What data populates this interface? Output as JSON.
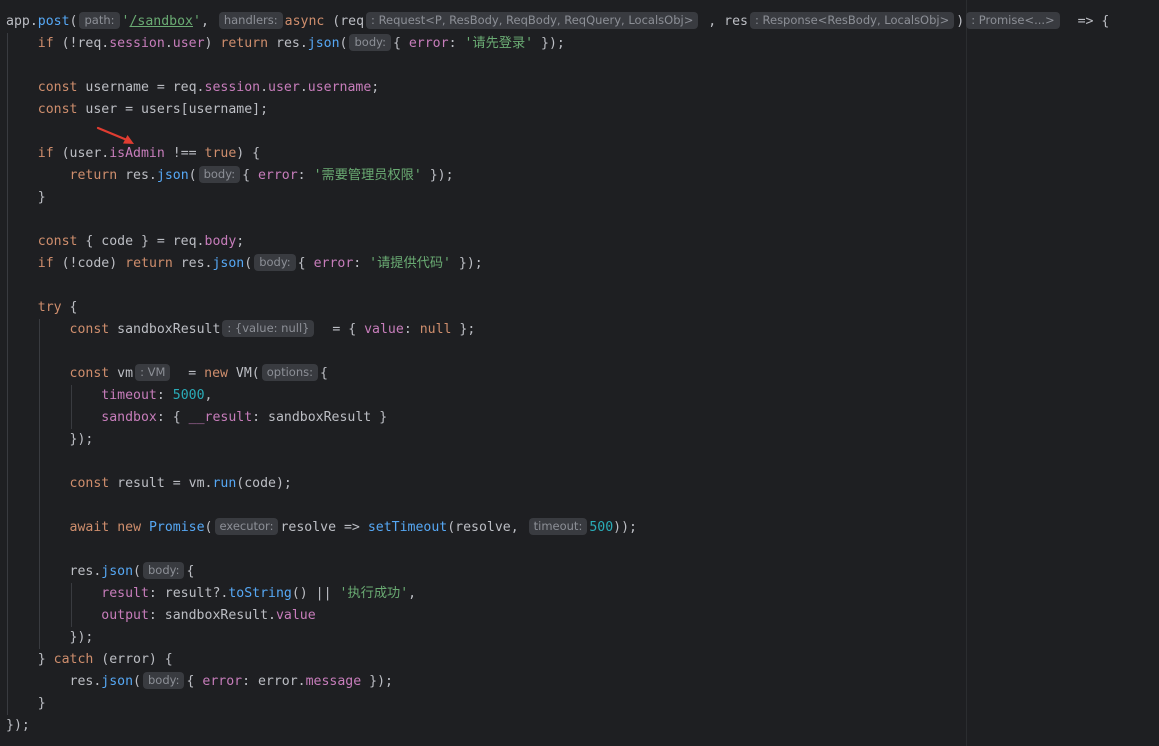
{
  "editor": {
    "lines": [
      [
        {
          "t": "plain",
          "v": "app."
        },
        {
          "t": "fn",
          "v": "post"
        },
        {
          "t": "plain",
          "v": "("
        },
        {
          "t": "hint",
          "v": "path:"
        },
        {
          "t": "str",
          "v": "'"
        },
        {
          "t": "link",
          "v": "/sandbox"
        },
        {
          "t": "str",
          "v": "'"
        },
        {
          "t": "plain",
          "v": ", "
        },
        {
          "t": "hint",
          "v": "handlers:"
        },
        {
          "t": "kw",
          "v": "async"
        },
        {
          "t": "plain",
          "v": " (req"
        },
        {
          "t": "hint",
          "v": ": Request<P, ResBody, ReqBody, ReqQuery, LocalsObj>"
        },
        {
          "t": "plain",
          "v": " , res"
        },
        {
          "t": "hint",
          "v": ": Response<ResBody, LocalsObj>"
        },
        {
          "t": "plain",
          "v": ")"
        },
        {
          "t": "hint",
          "v": ": Promise<...>"
        },
        {
          "t": "plain",
          "v": "  => {"
        }
      ],
      [
        {
          "t": "plain",
          "v": "    "
        },
        {
          "t": "kw",
          "v": "if"
        },
        {
          "t": "plain",
          "v": " (!req."
        },
        {
          "t": "prop",
          "v": "session"
        },
        {
          "t": "plain",
          "v": "."
        },
        {
          "t": "prop",
          "v": "user"
        },
        {
          "t": "plain",
          "v": ") "
        },
        {
          "t": "kw",
          "v": "return"
        },
        {
          "t": "plain",
          "v": " res."
        },
        {
          "t": "fn",
          "v": "json"
        },
        {
          "t": "plain",
          "v": "("
        },
        {
          "t": "hint",
          "v": "body:"
        },
        {
          "t": "plain",
          "v": "{ "
        },
        {
          "t": "prop",
          "v": "error"
        },
        {
          "t": "plain",
          "v": ": "
        },
        {
          "t": "str",
          "v": "'请先登录'"
        },
        {
          "t": "plain",
          "v": " });"
        }
      ],
      [],
      [
        {
          "t": "plain",
          "v": "    "
        },
        {
          "t": "kw",
          "v": "const"
        },
        {
          "t": "plain",
          "v": " username = req."
        },
        {
          "t": "prop",
          "v": "session"
        },
        {
          "t": "plain",
          "v": "."
        },
        {
          "t": "prop",
          "v": "user"
        },
        {
          "t": "plain",
          "v": "."
        },
        {
          "t": "prop",
          "v": "username"
        },
        {
          "t": "plain",
          "v": ";"
        }
      ],
      [
        {
          "t": "plain",
          "v": "    "
        },
        {
          "t": "kw",
          "v": "const"
        },
        {
          "t": "plain",
          "v": " user = users[username];"
        }
      ],
      [],
      [
        {
          "t": "plain",
          "v": "    "
        },
        {
          "t": "kw",
          "v": "if"
        },
        {
          "t": "plain",
          "v": " (user."
        },
        {
          "t": "prop",
          "v": "isAdmin"
        },
        {
          "t": "plain",
          "v": " !== "
        },
        {
          "t": "kw",
          "v": "true"
        },
        {
          "t": "plain",
          "v": ") {"
        }
      ],
      [
        {
          "t": "plain",
          "v": "        "
        },
        {
          "t": "kw",
          "v": "return"
        },
        {
          "t": "plain",
          "v": " res."
        },
        {
          "t": "fn",
          "v": "json"
        },
        {
          "t": "plain",
          "v": "("
        },
        {
          "t": "hint",
          "v": "body:"
        },
        {
          "t": "plain",
          "v": "{ "
        },
        {
          "t": "prop",
          "v": "error"
        },
        {
          "t": "plain",
          "v": ": "
        },
        {
          "t": "str",
          "v": "'需要管理员权限'"
        },
        {
          "t": "plain",
          "v": " });"
        }
      ],
      [
        {
          "t": "plain",
          "v": "    }"
        }
      ],
      [],
      [
        {
          "t": "plain",
          "v": "    "
        },
        {
          "t": "kw",
          "v": "const"
        },
        {
          "t": "plain",
          "v": " { code } = req."
        },
        {
          "t": "prop",
          "v": "body"
        },
        {
          "t": "plain",
          "v": ";"
        }
      ],
      [
        {
          "t": "plain",
          "v": "    "
        },
        {
          "t": "kw",
          "v": "if"
        },
        {
          "t": "plain",
          "v": " (!code) "
        },
        {
          "t": "kw",
          "v": "return"
        },
        {
          "t": "plain",
          "v": " res."
        },
        {
          "t": "fn",
          "v": "json"
        },
        {
          "t": "plain",
          "v": "("
        },
        {
          "t": "hint",
          "v": "body:"
        },
        {
          "t": "plain",
          "v": "{ "
        },
        {
          "t": "prop",
          "v": "error"
        },
        {
          "t": "plain",
          "v": ": "
        },
        {
          "t": "str",
          "v": "'请提供代码'"
        },
        {
          "t": "plain",
          "v": " });"
        }
      ],
      [],
      [
        {
          "t": "plain",
          "v": "    "
        },
        {
          "t": "kw",
          "v": "try"
        },
        {
          "t": "plain",
          "v": " {"
        }
      ],
      [
        {
          "t": "plain",
          "v": "        "
        },
        {
          "t": "kw",
          "v": "const"
        },
        {
          "t": "plain",
          "v": " sandboxResult"
        },
        {
          "t": "hint",
          "v": ": {value: null}"
        },
        {
          "t": "plain",
          "v": "  = { "
        },
        {
          "t": "prop",
          "v": "value"
        },
        {
          "t": "plain",
          "v": ": "
        },
        {
          "t": "kw",
          "v": "null"
        },
        {
          "t": "plain",
          "v": " };"
        }
      ],
      [],
      [
        {
          "t": "plain",
          "v": "        "
        },
        {
          "t": "kw",
          "v": "const"
        },
        {
          "t": "plain",
          "v": " vm"
        },
        {
          "t": "hint",
          "v": ": VM"
        },
        {
          "t": "plain",
          "v": "  = "
        },
        {
          "t": "kw",
          "v": "new"
        },
        {
          "t": "plain",
          "v": " VM("
        },
        {
          "t": "hint",
          "v": "options:"
        },
        {
          "t": "plain",
          "v": "{"
        }
      ],
      [
        {
          "t": "plain",
          "v": "            "
        },
        {
          "t": "prop",
          "v": "timeout"
        },
        {
          "t": "plain",
          "v": ": "
        },
        {
          "t": "num",
          "v": "5000"
        },
        {
          "t": "plain",
          "v": ","
        }
      ],
      [
        {
          "t": "plain",
          "v": "            "
        },
        {
          "t": "prop",
          "v": "sandbox"
        },
        {
          "t": "plain",
          "v": ": { "
        },
        {
          "t": "prop",
          "v": "__result"
        },
        {
          "t": "plain",
          "v": ": sandboxResult }"
        }
      ],
      [
        {
          "t": "plain",
          "v": "        });"
        }
      ],
      [],
      [
        {
          "t": "plain",
          "v": "        "
        },
        {
          "t": "kw",
          "v": "const"
        },
        {
          "t": "plain",
          "v": " result = vm."
        },
        {
          "t": "fn",
          "v": "run"
        },
        {
          "t": "plain",
          "v": "(code);"
        }
      ],
      [],
      [
        {
          "t": "plain",
          "v": "        "
        },
        {
          "t": "kw",
          "v": "await"
        },
        {
          "t": "plain",
          "v": " "
        },
        {
          "t": "kw",
          "v": "new"
        },
        {
          "t": "plain",
          "v": " "
        },
        {
          "t": "fn",
          "v": "Promise"
        },
        {
          "t": "plain",
          "v": "("
        },
        {
          "t": "hint",
          "v": "executor:"
        },
        {
          "t": "plain",
          "v": "resolve => "
        },
        {
          "t": "fn",
          "v": "setTimeout"
        },
        {
          "t": "plain",
          "v": "(resolve, "
        },
        {
          "t": "hint",
          "v": "timeout:"
        },
        {
          "t": "num",
          "v": "500"
        },
        {
          "t": "plain",
          "v": "));"
        }
      ],
      [],
      [
        {
          "t": "plain",
          "v": "        res."
        },
        {
          "t": "fn",
          "v": "json"
        },
        {
          "t": "plain",
          "v": "("
        },
        {
          "t": "hint",
          "v": "body:"
        },
        {
          "t": "plain",
          "v": "{"
        }
      ],
      [
        {
          "t": "plain",
          "v": "            "
        },
        {
          "t": "prop",
          "v": "result"
        },
        {
          "t": "plain",
          "v": ": result?."
        },
        {
          "t": "fn",
          "v": "toString"
        },
        {
          "t": "plain",
          "v": "() || "
        },
        {
          "t": "str",
          "v": "'执行成功'"
        },
        {
          "t": "plain",
          "v": ","
        }
      ],
      [
        {
          "t": "plain",
          "v": "            "
        },
        {
          "t": "prop",
          "v": "output"
        },
        {
          "t": "plain",
          "v": ": sandboxResult."
        },
        {
          "t": "prop",
          "v": "value"
        }
      ],
      [
        {
          "t": "plain",
          "v": "        });"
        }
      ],
      [
        {
          "t": "plain",
          "v": "    } "
        },
        {
          "t": "kw",
          "v": "catch"
        },
        {
          "t": "plain",
          "v": " (error) {"
        }
      ],
      [
        {
          "t": "plain",
          "v": "        res."
        },
        {
          "t": "fn",
          "v": "json"
        },
        {
          "t": "plain",
          "v": "("
        },
        {
          "t": "hint",
          "v": "body:"
        },
        {
          "t": "plain",
          "v": "{ "
        },
        {
          "t": "prop",
          "v": "error"
        },
        {
          "t": "plain",
          "v": ": error."
        },
        {
          "t": "prop",
          "v": "message"
        },
        {
          "t": "plain",
          "v": " });"
        }
      ],
      [
        {
          "t": "plain",
          "v": "    }"
        }
      ],
      [
        {
          "t": "plain",
          "v": "});"
        }
      ]
    ]
  },
  "colors": {
    "background": "#1e1f22",
    "keyword": "#cf8e6d",
    "string": "#6aab73",
    "number": "#2aacb8",
    "function": "#56a8f5",
    "property": "#c77dbb",
    "plain": "#bcbec4",
    "hint_background": "#393b40",
    "hint_text": "#8c8f96",
    "annotation_arrow": "#e03c31"
  },
  "annotation": {
    "icon": "red-arrow-icon",
    "target": "isAdmin"
  }
}
